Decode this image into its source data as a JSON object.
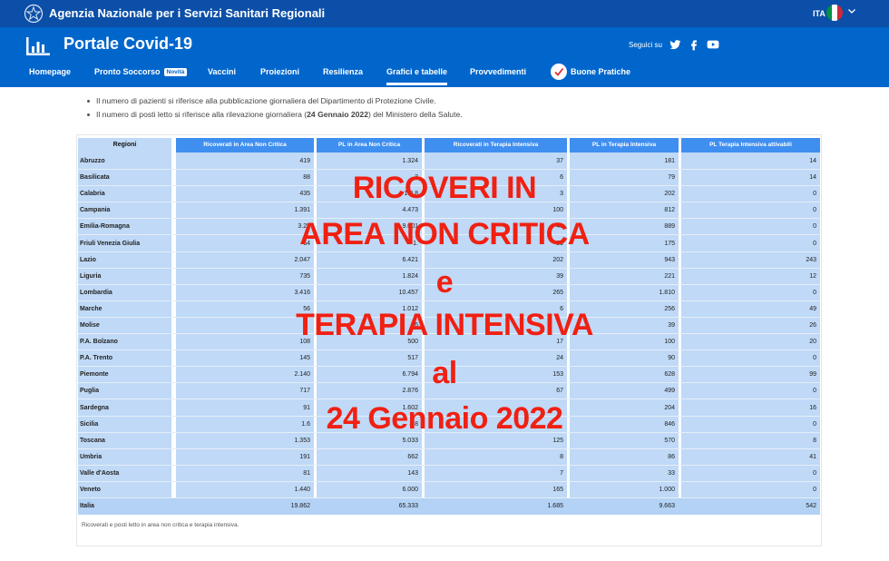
{
  "topbar": {
    "agency": "Agenzia Nazionale per i Servizi Sanitari Regionali",
    "lang": "ITA"
  },
  "header": {
    "title": "Portale Covid-19",
    "follow": "Seguici su",
    "nav": [
      {
        "label": "Homepage"
      },
      {
        "label": "Pronto Soccorso",
        "badge": "Novità"
      },
      {
        "label": "Vaccini"
      },
      {
        "label": "Proiezioni"
      },
      {
        "label": "Resilienza"
      },
      {
        "label": "Grafici e tabelle"
      },
      {
        "label": "Provvedimenti"
      },
      {
        "label": "Buone Pratiche"
      }
    ]
  },
  "notes": [
    "Il numero di pazienti si riferisce alla pubblicazione giornaliera del Dipartimento di Protezione Civile.",
    {
      "pre": "Il numero di posti letto si riferisce alla rilevazione giornaliera (",
      "bold": "24 Gennaio 2022",
      "post": ") del Ministero della Salute."
    }
  ],
  "table": {
    "headers": [
      "Regioni",
      "Ricoverati in Area Non Critica",
      "PL in Area Non Critica",
      "Ricoverati in Terapia Intensiva",
      "PL in Terapia Intensiva",
      "PL Terapia Intensiva attivabili"
    ],
    "rows": [
      [
        "Abruzzo",
        "419",
        "1.324",
        "37",
        "181",
        "14"
      ],
      [
        "Basilicata",
        "88",
        "3",
        "6",
        "79",
        "14"
      ],
      [
        "Calabria",
        "435",
        "1.0 8",
        "3",
        "202",
        "0"
      ],
      [
        "Campania",
        "1.391",
        "4.473",
        "100",
        "812",
        "0"
      ],
      [
        "Emilia-Romagna",
        "3.25",
        "9.001",
        "48",
        "889",
        "0"
      ],
      [
        "Friuli Venezia Giulia",
        "64",
        "1.",
        "39",
        "175",
        "0"
      ],
      [
        "Lazio",
        "2.047",
        "6.421",
        "202",
        "943",
        "243"
      ],
      [
        "Liguria",
        "735",
        "1.824",
        "39",
        "221",
        "12"
      ],
      [
        "Lombardia",
        "3.416",
        "10.457",
        "265",
        "1.810",
        "0"
      ],
      [
        "Marche",
        "56",
        "1.012",
        "6",
        "256",
        "49"
      ],
      [
        "Molise",
        "",
        "76",
        "",
        "39",
        "26"
      ],
      [
        "P.A. Bolzano",
        "108",
        "500",
        "17",
        "100",
        "20"
      ],
      [
        "P.A. Trento",
        "145",
        "517",
        "24",
        "90",
        "0"
      ],
      [
        "Piemonte",
        "2.140",
        "6.794",
        "153",
        "628",
        "99"
      ],
      [
        "Puglia",
        "717",
        "2.876",
        "67",
        "499",
        "0"
      ],
      [
        "Sardegna",
        "91",
        "1.602",
        "",
        "204",
        "16"
      ],
      [
        "Sicilia",
        "1.6",
        "3.8",
        "",
        "846",
        "0"
      ],
      [
        "Toscana",
        "1.353",
        "5.033",
        "125",
        "570",
        "8"
      ],
      [
        "Umbria",
        "191",
        "662",
        "8",
        "86",
        "41"
      ],
      [
        "Valle d'Aosta",
        "81",
        "143",
        "7",
        "33",
        "0"
      ],
      [
        "Veneto",
        "1.440",
        "6.000",
        "165",
        "1.000",
        "0"
      ]
    ],
    "total": [
      "Italia",
      "19.862",
      "65.333",
      "1.685",
      "9.663",
      "542"
    ],
    "note": "Ricoverati e posti letto in area non critica e terapia intensiva."
  },
  "overlay": [
    "RICOVERI IN",
    "AREA NON CRITICA",
    "e",
    "TERAPIA INTENSIVA",
    "al",
    "24 Gennaio 2022"
  ],
  "colors": {
    "topbar": "#0b4fa8",
    "header": "#0066cc",
    "table_header": "#3f8ff0",
    "table_cell": "#bfd9f7",
    "overlay": "#f02012"
  }
}
